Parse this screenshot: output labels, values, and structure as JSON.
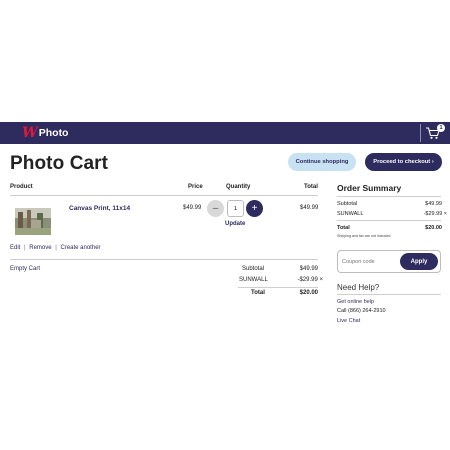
{
  "navbar": {
    "logo_mark": "W",
    "logo_text": "Photo",
    "cart_icon": "shopping-cart-icon",
    "cart_count": "1",
    "background": "#2e2b5f"
  },
  "page": {
    "title": "Photo Cart"
  },
  "actions": {
    "continue_label": "Continue shopping",
    "checkout_label": "Proceed to checkout ›"
  },
  "table": {
    "headers": {
      "product": "Product",
      "price": "Price",
      "quantity": "Quantity",
      "total": "Total"
    },
    "items": [
      {
        "name": "Canvas Print, 11x14",
        "price": "$49.99",
        "quantity": "1",
        "minus": "–",
        "plus": "+",
        "update": "Update",
        "total": "$49.99",
        "edit": "Edit",
        "remove": "Remove",
        "create": "Create another",
        "separator": "|"
      }
    ],
    "empty_cart": "Empty Cart"
  },
  "cart_summary": {
    "subtotal_label": "Subtotal",
    "subtotal_value": "$49.99",
    "coupon_label": "SUNWALL",
    "coupon_value": "-$29.99 ×",
    "total_label": "Total",
    "total_value": "$20.00"
  },
  "order_summary": {
    "title": "Order Summary",
    "subtotal_label": "Subtotal",
    "subtotal_value": "$49.99",
    "coupon_label": "SUNWALL",
    "coupon_value": "-$29.99 ×",
    "total_label": "Total",
    "total_value": "$20.00",
    "note": "Shipping and tax are not included."
  },
  "coupon": {
    "placeholder": "Coupon code",
    "apply_label": "Apply"
  },
  "help": {
    "title": "Need Help?",
    "online": "Get online help",
    "phone": "Call (866) 264-2910",
    "chat": "Live Chat"
  },
  "colors": {
    "brand": "#2e2b5f",
    "accent": "#e3173e",
    "light_button": "#c8e1f3"
  }
}
